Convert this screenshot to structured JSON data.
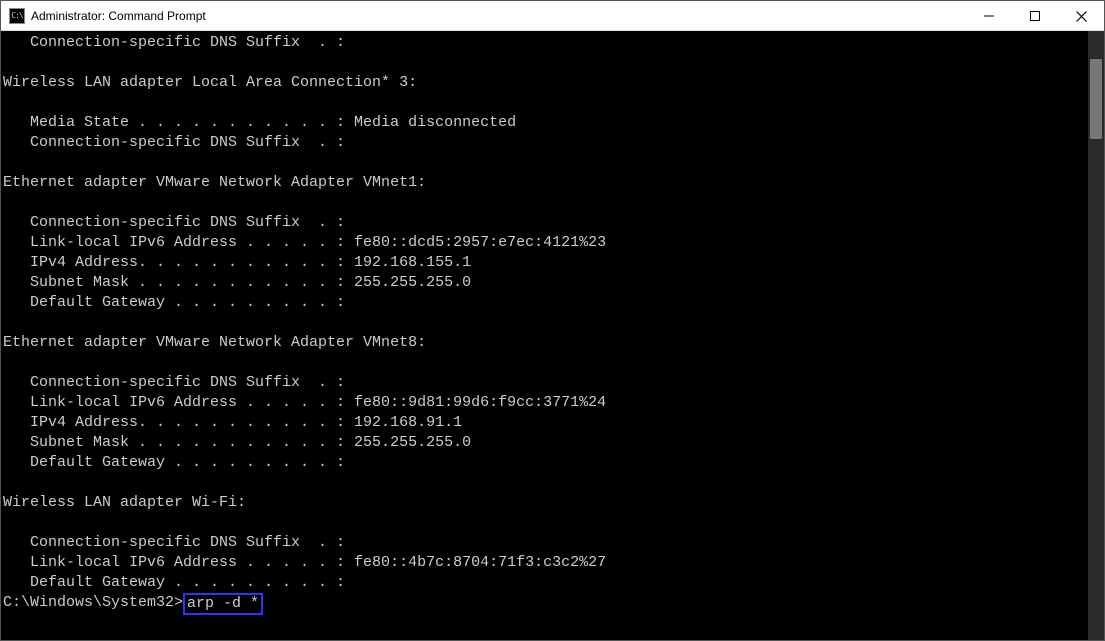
{
  "window": {
    "title": "Administrator: Command Prompt",
    "icon_label": "C:\\"
  },
  "terminal": {
    "lines": [
      "   Connection-specific DNS Suffix  . :",
      "",
      "Wireless LAN adapter Local Area Connection* 3:",
      "",
      "   Media State . . . . . . . . . . . : Media disconnected",
      "   Connection-specific DNS Suffix  . :",
      "",
      "Ethernet adapter VMware Network Adapter VMnet1:",
      "",
      "   Connection-specific DNS Suffix  . :",
      "   Link-local IPv6 Address . . . . . : fe80::dcd5:2957:e7ec:4121%23",
      "   IPv4 Address. . . . . . . . . . . : 192.168.155.1",
      "   Subnet Mask . . . . . . . . . . . : 255.255.255.0",
      "   Default Gateway . . . . . . . . . :",
      "",
      "Ethernet adapter VMware Network Adapter VMnet8:",
      "",
      "   Connection-specific DNS Suffix  . :",
      "   Link-local IPv6 Address . . . . . : fe80::9d81:99d6:f9cc:3771%24",
      "   IPv4 Address. . . . . . . . . . . : 192.168.91.1",
      "   Subnet Mask . . . . . . . . . . . : 255.255.255.0",
      "   Default Gateway . . . . . . . . . :",
      "",
      "Wireless LAN adapter Wi-Fi:",
      "",
      "   Connection-specific DNS Suffix  . :",
      "   Link-local IPv6 Address . . . . . : fe80::4b7c:8704:71f3:c3c2%27",
      "   Default Gateway . . . . . . . . . :",
      ""
    ],
    "prompt": "C:\\Windows\\System32>",
    "command": "arp -d *"
  }
}
